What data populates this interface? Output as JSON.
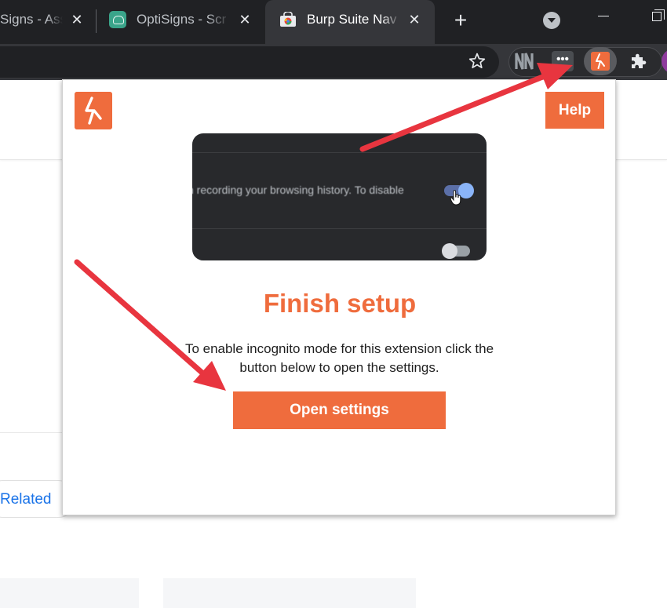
{
  "tabs": [
    {
      "title": "Signs - Ass",
      "active": false
    },
    {
      "title": "OptiSigns - Scr",
      "active": false
    },
    {
      "title": "Burp Suite Nav",
      "active": true
    }
  ],
  "tab_close_glyph": "✕",
  "new_tab_glyph": "+",
  "toolbar": {
    "bookmark_icon": "star-icon",
    "extensions": [
      "nn-extension-icon",
      "dots-extension-icon",
      "burp-extension-icon",
      "puzzle-extensions-icon"
    ],
    "dots_glyph": "•••",
    "puzzle_glyph": "✚"
  },
  "page": {
    "related_label": "Related"
  },
  "popup": {
    "help_label": "Help",
    "preview_text": "n recording your browsing history. To disable",
    "title": "Finish setup",
    "description": "To enable incognito mode for this extension click the button below to open the settings.",
    "button_label": "Open settings"
  },
  "colors": {
    "accent": "#ef6c3d",
    "arrow": "#e8353f",
    "chrome_dark": "#202124",
    "toolbar": "#35363a",
    "link": "#1a73e8"
  }
}
